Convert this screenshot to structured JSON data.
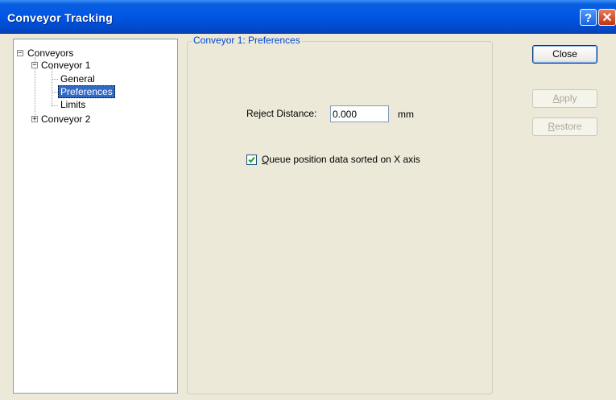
{
  "window": {
    "title": "Conveyor Tracking",
    "help_button": "?",
    "close_button": "✕"
  },
  "tree": {
    "root": {
      "label": "Conveyors",
      "expander": "−"
    },
    "conveyor1": {
      "label": "Conveyor 1",
      "expander": "−"
    },
    "children": [
      {
        "label": "General"
      },
      {
        "label": "Preferences",
        "selected": true
      },
      {
        "label": "Limits"
      }
    ],
    "conveyor2": {
      "label": "Conveyor 2",
      "expander": "+"
    }
  },
  "panel": {
    "group_title": "Conveyor 1: Preferences",
    "reject_distance": {
      "label_pre": "Re",
      "label_accel": "j",
      "label_post": "ect Distance:",
      "value": "0.000",
      "unit": "mm"
    },
    "queue_sort": {
      "checked": true,
      "label_accel": "Q",
      "label_post": "ueue position data sorted on X axis"
    }
  },
  "buttons": {
    "close": {
      "label": "Close"
    },
    "apply": {
      "accel": "A",
      "rest": "pply",
      "disabled": true
    },
    "restore": {
      "accel": "R",
      "rest": "estore",
      "disabled": true
    }
  }
}
